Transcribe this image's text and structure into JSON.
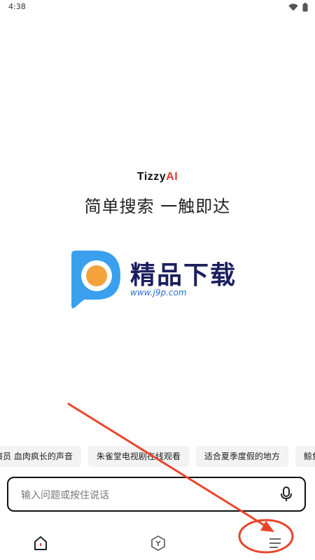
{
  "status": {
    "time": "4:38"
  },
  "brand": {
    "name": "Tizzy",
    "name_suffix": "AI",
    "tagline": "简单搜索 一触即达"
  },
  "watermark": {
    "title": "精品下载",
    "url": "www.j9p.com"
  },
  "chips": [
    "演员 血肉疯长的声音",
    "朱雀堂电视剧在线观看",
    "适合夏季度假的地方",
    "鲸鱼杂货铺"
  ],
  "search": {
    "placeholder": "输入问题或按住说话",
    "value": ""
  },
  "nav": {
    "tabs": [
      "home",
      "explore",
      "menu"
    ]
  },
  "colors": {
    "accent": "#e53935",
    "annotation": "#e8452c",
    "chip_bg": "#f3f3f3"
  }
}
